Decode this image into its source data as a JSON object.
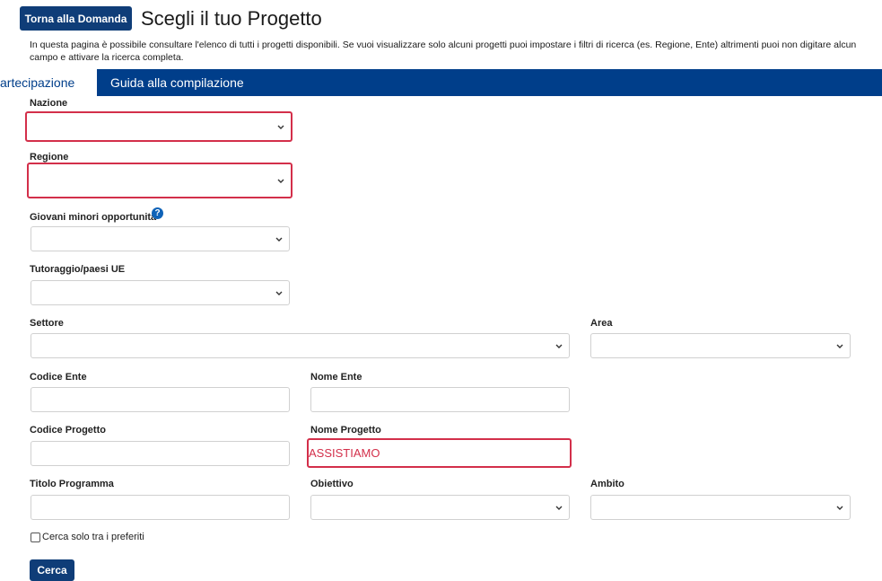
{
  "header": {
    "back_button": "Torna alla Domanda",
    "title": "Scegli il tuo Progetto",
    "intro": "In questa pagina è possibile consultare l'elenco di tutti i progetti disponibili. Se vuoi visualizzare solo alcuni progetti puoi impostare i filtri di ricerca (es. Regione, Ente) altrimenti puoi non digitare alcun campo e attivare la ricerca completa."
  },
  "tabs": {
    "active": "artecipazione",
    "guide": "Guida alla compilazione"
  },
  "form": {
    "nazione_label": "Nazione",
    "regione_label": "Regione",
    "giovani_label": "Giovani minori opportunità",
    "tutoraggio_label": "Tutoraggio/paesi UE",
    "settore_label": "Settore",
    "area_label": "Area",
    "codice_ente_label": "Codice Ente",
    "nome_ente_label": "Nome Ente",
    "codice_progetto_label": "Codice Progetto",
    "nome_progetto_label": "Nome Progetto",
    "nome_progetto_value": "ASSISTIAMO",
    "titolo_programma_label": "Titolo Programma",
    "obiettivo_label": "Obiettivo",
    "ambito_label": "Ambito",
    "preferiti_label": "Cerca solo tra i preferiti",
    "search_button": "Cerca"
  },
  "colors": {
    "primary": "#0f3d78",
    "navbar": "#003e8a",
    "highlight": "#d32f4a"
  }
}
